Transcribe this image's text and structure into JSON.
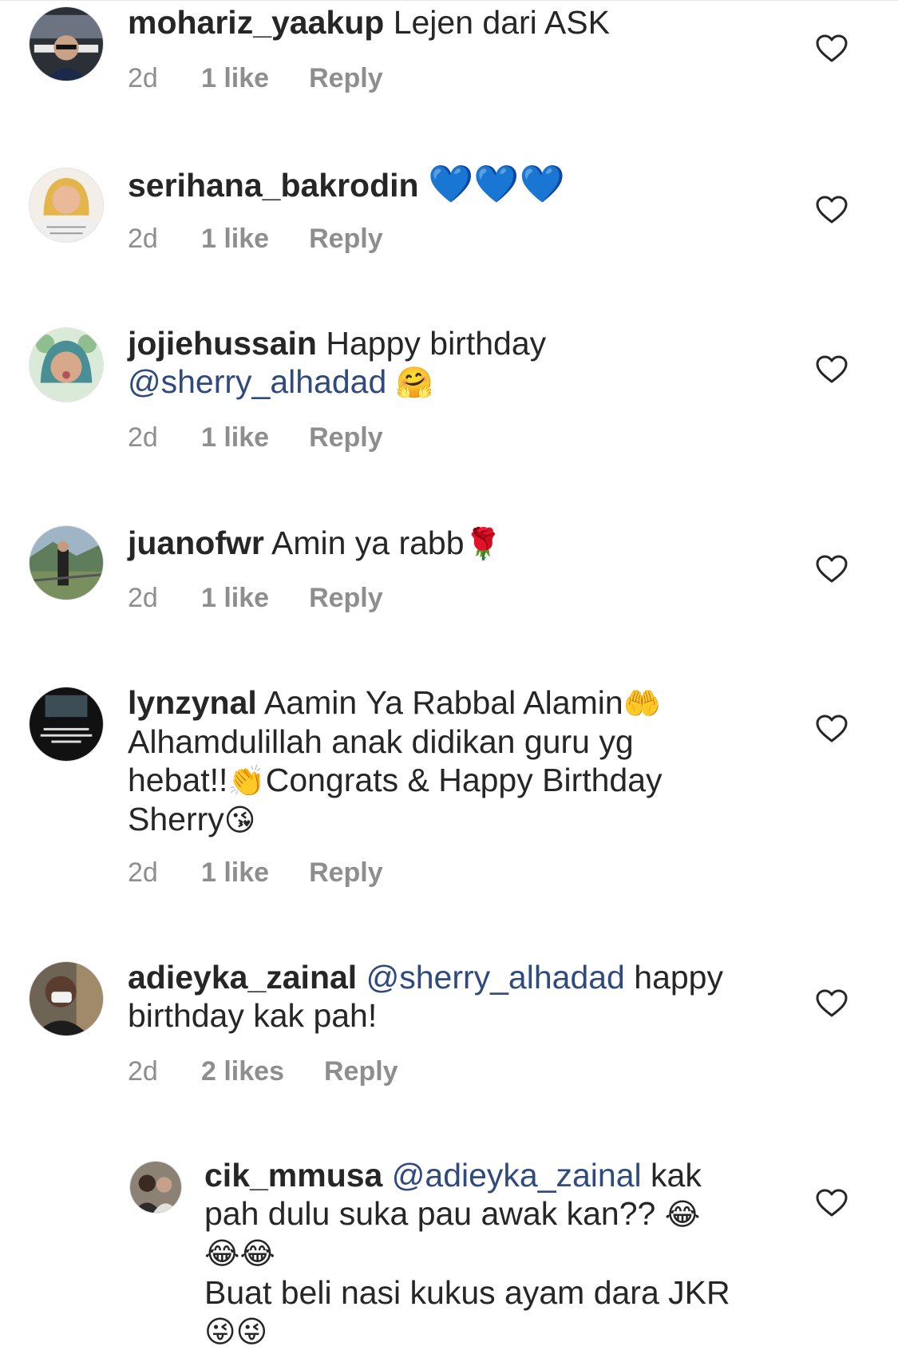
{
  "comments": [
    {
      "user": "mohariz_yaakup",
      "text": "Lejen dari ASK",
      "time": "2d",
      "likes": "1 like",
      "reply": "Reply"
    },
    {
      "user": "serihana_bakrodin",
      "text": "💙💙💙",
      "time": "2d",
      "likes": "1 like",
      "reply": "Reply"
    },
    {
      "user": "jojiehussain",
      "text1": "Happy birthday",
      "mention": "@sherry_alhadad",
      "emoji": "🤗",
      "time": "2d",
      "likes": "1 like",
      "reply": "Reply"
    },
    {
      "user": "juanofwr",
      "text": "Amin ya rabb",
      "emoji": "🌹",
      "time": "2d",
      "likes": "1 like",
      "reply": "Reply"
    },
    {
      "user": "lynzynal",
      "line1": "Aamin Ya Rabbal Alamin",
      "emoji1": "🤲",
      "line2": "Alhamdulillah anak didikan guru yg",
      "line3a": "hebat!!",
      "emoji2": "👏",
      "line3b": "Congrats & Happy Birthday",
      "line4": "Sherry",
      "emoji3": "😘",
      "time": "2d",
      "likes": "1 like",
      "reply": "Reply"
    },
    {
      "user": "adieyka_zainal",
      "mention": "@sherry_alhadad",
      "text1": "happy",
      "text2": "birthday kak pah!",
      "time": "2d",
      "likes": "2 likes",
      "reply": "Reply"
    },
    {
      "user": "cik_mmusa",
      "mention": "@adieyka_zainal",
      "text1": "kak",
      "text2": "pah dulu suka pau awak kan??",
      "emoji1": "😂",
      "emoji2": "😂😂",
      "text3": "Buat beli nasi kukus ayam dara JKR",
      "emoji3": "😜😜"
    }
  ],
  "icons": {
    "like": "heart-outline-icon"
  },
  "colors": {
    "text": "#262626",
    "meta": "#8e8e8e",
    "mention": "#2f4a7e",
    "heart": "#262626"
  }
}
